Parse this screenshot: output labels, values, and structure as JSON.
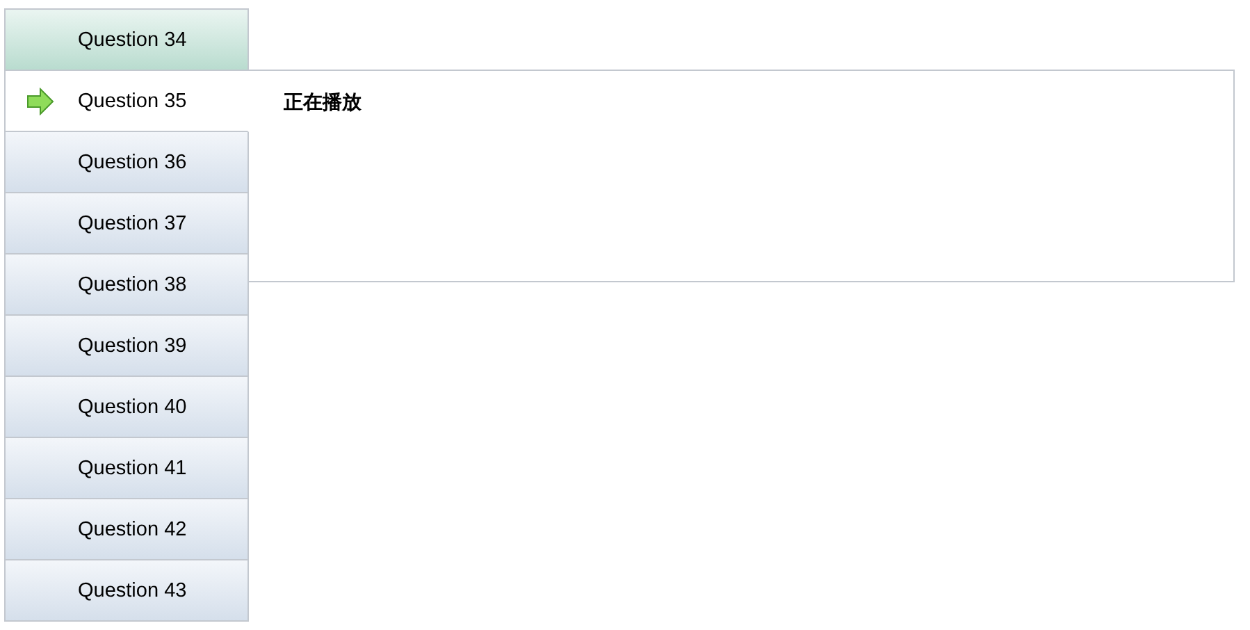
{
  "questions": [
    {
      "label": "Question 34",
      "selected": false,
      "highlighted": true
    },
    {
      "label": "Question 35",
      "selected": true,
      "highlighted": false
    },
    {
      "label": "Question 36",
      "selected": false,
      "highlighted": false
    },
    {
      "label": "Question 37",
      "selected": false,
      "highlighted": false
    },
    {
      "label": "Question 38",
      "selected": false,
      "highlighted": false
    },
    {
      "label": "Question 39",
      "selected": false,
      "highlighted": false
    },
    {
      "label": "Question 40",
      "selected": false,
      "highlighted": false
    },
    {
      "label": "Question 41",
      "selected": false,
      "highlighted": false
    },
    {
      "label": "Question 42",
      "selected": false,
      "highlighted": false
    },
    {
      "label": "Question 43",
      "selected": false,
      "highlighted": false
    }
  ],
  "panel": {
    "status": "正在播放"
  }
}
